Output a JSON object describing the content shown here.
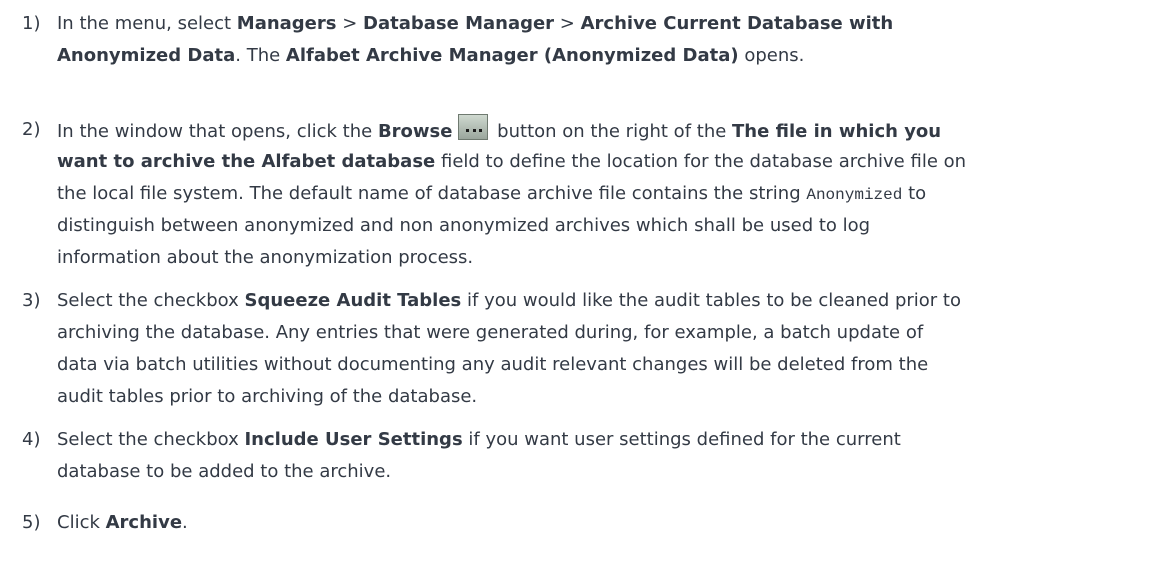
{
  "steps": [
    {
      "number": "1)",
      "lines": [
        [
          {
            "t": "In the menu, select "
          },
          {
            "t": "Managers",
            "b": true
          },
          {
            "t": " > "
          },
          {
            "t": "Database Manager",
            "b": true
          },
          {
            "t": " > "
          },
          {
            "t": "Archive Current Database with",
            "b": true
          }
        ],
        [
          {
            "t": "Anonymized Data",
            "b": true
          },
          {
            "t": ". The "
          },
          {
            "t": "Alfabet Archive Manager (Anonymized Data)",
            "b": true
          },
          {
            "t": " opens."
          }
        ]
      ]
    },
    {
      "number": "2)",
      "lines": [
        [
          {
            "t": "In the window that opens, click the "
          },
          {
            "t": "Browse",
            "b": true
          },
          {
            "icon": "browse-button-icon"
          },
          {
            "t": " button on the right of the "
          },
          {
            "t": "The file in which you",
            "b": true
          }
        ],
        [
          {
            "t": "want to archive the Alfabet database",
            "b": true
          },
          {
            "t": " field to define the location for the database archive file on"
          }
        ],
        [
          {
            "t": "the local file system. The default name of database archive file contains the string "
          },
          {
            "t": "Anonymized",
            "m": true
          },
          {
            "t": " to"
          }
        ],
        [
          {
            "t": "distinguish between anonymized and non anonymized archives which shall be used to log"
          }
        ],
        [
          {
            "t": "information about the anonymization process."
          }
        ]
      ]
    },
    {
      "number": "3)",
      "lines": [
        [
          {
            "t": "Select the checkbox "
          },
          {
            "t": "Squeeze Audit Tables",
            "b": true
          },
          {
            "t": " if you would like the audit tables to be cleaned prior to"
          }
        ],
        [
          {
            "t": "archiving the database. Any entries that were generated during, for example, a batch update of"
          }
        ],
        [
          {
            "t": "data via batch utilities without documenting any audit relevant changes will be deleted from the"
          }
        ],
        [
          {
            "t": "audit tables prior to archiving of the database."
          }
        ]
      ]
    },
    {
      "number": "4)",
      "lines": [
        [
          {
            "t": "Select the checkbox "
          },
          {
            "t": "Include User Settings",
            "b": true
          },
          {
            "t": " if you want user settings defined for the current"
          }
        ],
        [
          {
            "t": "database to be added to the archive."
          }
        ]
      ]
    },
    {
      "number": "5)",
      "lines": [
        [
          {
            "t": "Click "
          },
          {
            "t": "Archive",
            "b": true
          },
          {
            "t": "."
          }
        ]
      ]
    }
  ]
}
